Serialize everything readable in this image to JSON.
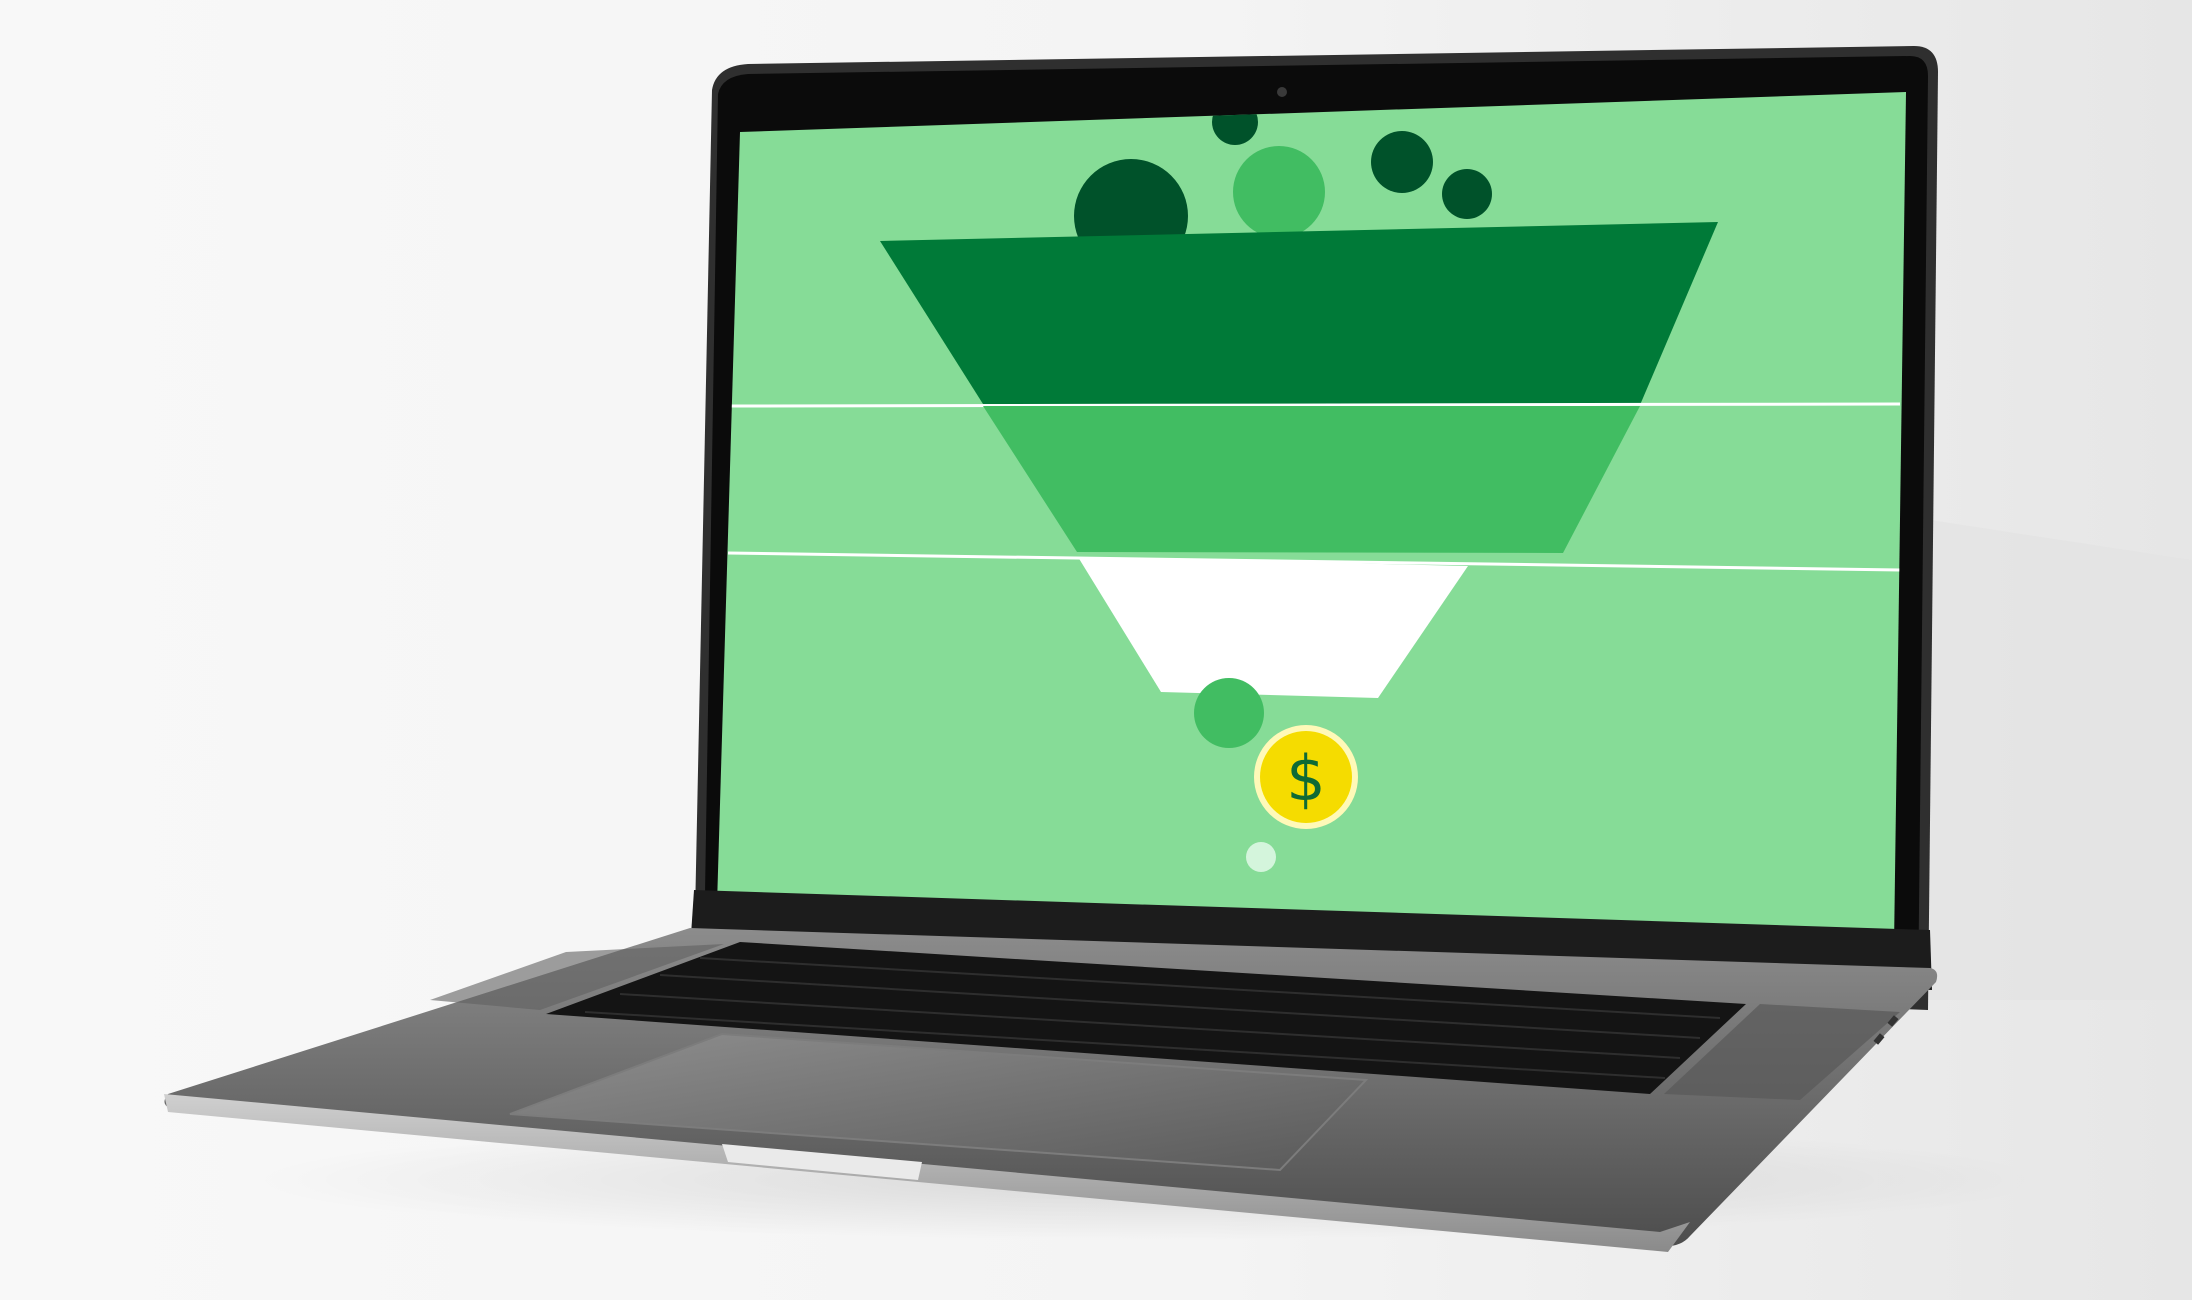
{
  "scene": {
    "subject": "laptop",
    "screen_graphic": "sales-funnel"
  },
  "colors": {
    "background_light": "#f7f7f7",
    "background_shadow": "#dcdcdc",
    "screen_bg": "#86dc97",
    "funnel_top": "#007a38",
    "funnel_middle": "#41bd62",
    "funnel_bottom": "#ffffff",
    "bubble_dark": "#00522a",
    "bubble_mid": "#41bd62",
    "bubble_light": "#d4f5dc",
    "coin_fill": "#f5dc00",
    "coin_ring": "#fff9b8",
    "coin_symbol": "#0e6a35",
    "laptop_body": "#a6a6a6",
    "laptop_dark": "#2b2b2b",
    "bezel": "#0c0c0c",
    "keyboard": "#121212"
  },
  "icons": {
    "coin": "dollar-coin-icon"
  },
  "coin": {
    "symbol": "$"
  }
}
